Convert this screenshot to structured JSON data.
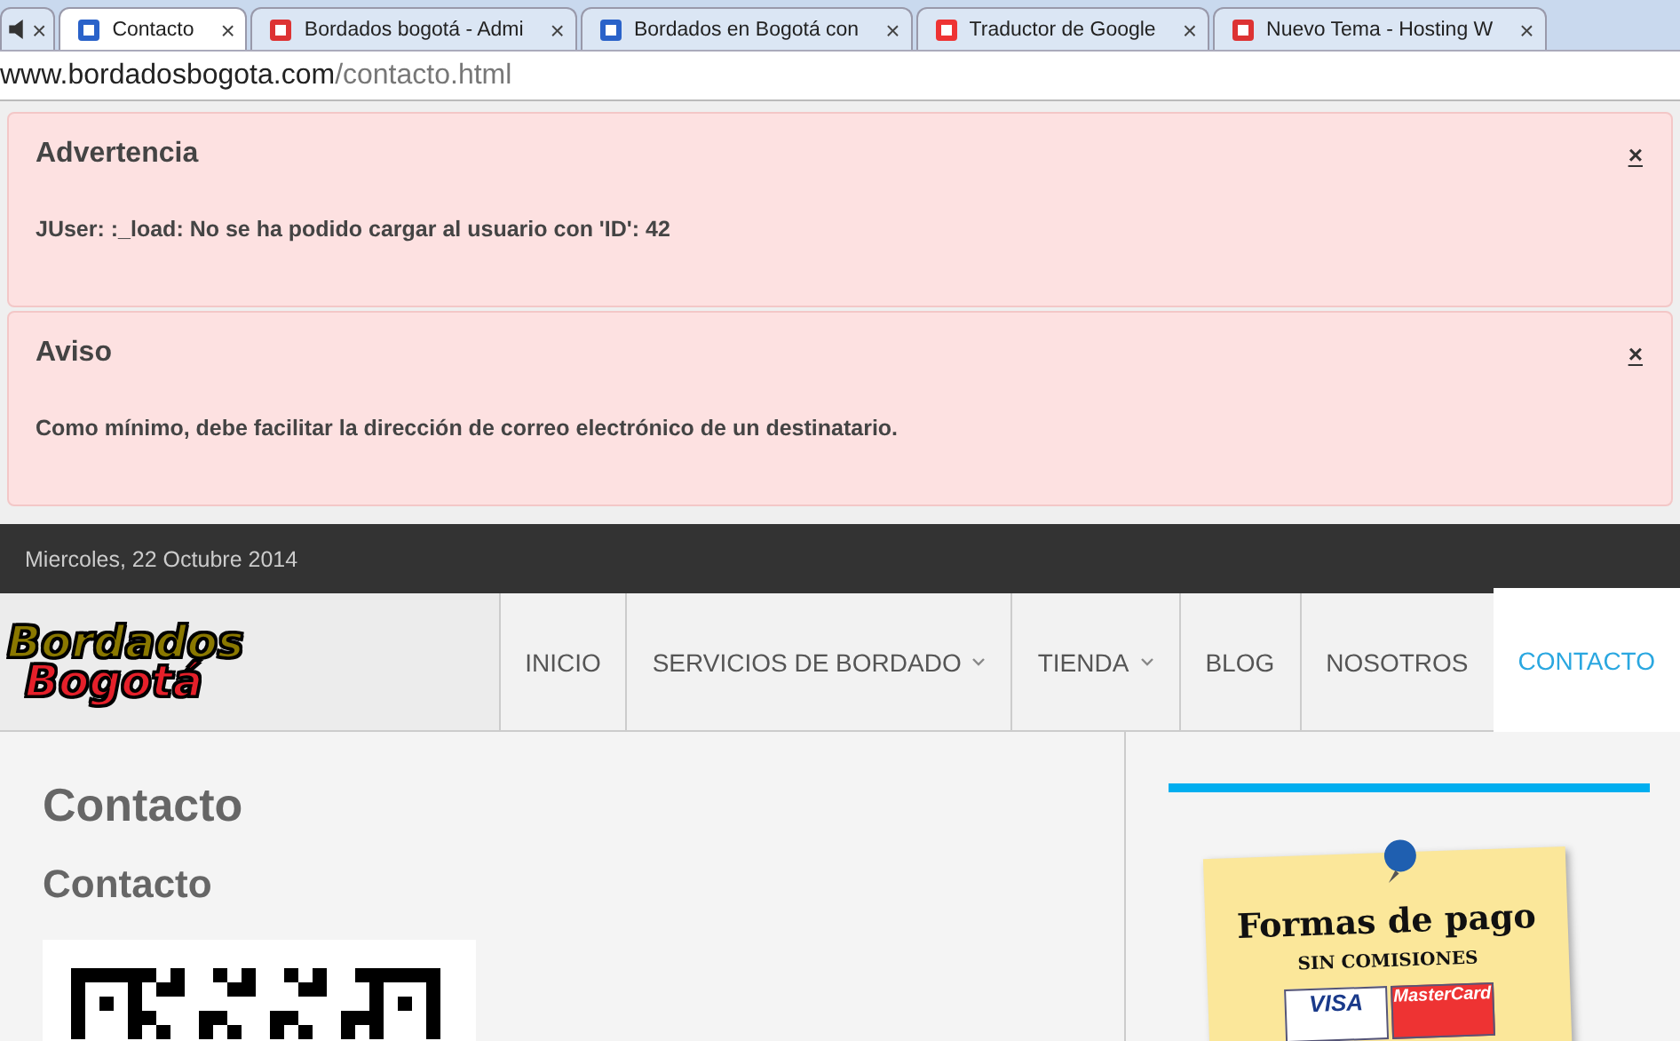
{
  "browser": {
    "tabs": [
      {
        "selected": false,
        "kind": "audio"
      },
      {
        "title": "Contacto",
        "selected": true,
        "kind": "page"
      },
      {
        "title": "Bordados bogotá - Admi",
        "selected": false,
        "kind": "page"
      },
      {
        "title": "Bordados en Bogotá con",
        "selected": false,
        "kind": "page"
      },
      {
        "title": "Traductor de Google",
        "selected": false,
        "kind": "page"
      },
      {
        "title": "Nuevo Tema - Hosting W",
        "selected": false,
        "kind": "page"
      }
    ],
    "close_glyph": "×",
    "address": {
      "host": "www.bordadosbogota.com",
      "path": "/contacto.html"
    }
  },
  "alerts": [
    {
      "title": "Advertencia",
      "close": "×",
      "message": "JUser: :_load: No se ha podido cargar al usuario con 'ID': 42"
    },
    {
      "title": "Aviso",
      "close": "×",
      "message": "Como mínimo, debe facilitar la dirección de correo electrónico de un destinatario."
    }
  ],
  "top_bar": {
    "date": "Miercoles, 22 Octubre 2014"
  },
  "logo": {
    "line_1": "Bordados",
    "line_2": "Bogotá"
  },
  "nav": [
    {
      "label": "INICIO",
      "selected": false,
      "has_menu": false
    },
    {
      "label": "SERVICIOS DE BORDADO",
      "selected": false,
      "has_menu": true
    },
    {
      "label": "TIENDA",
      "selected": false,
      "has_menu": true
    },
    {
      "label": "BLOG",
      "selected": false,
      "has_menu": false
    },
    {
      "label": "NOSOTROS",
      "selected": false,
      "has_menu": false
    },
    {
      "label": "CONTACTO",
      "selected": true,
      "has_menu": false
    }
  ],
  "content": {
    "heading": "Contacto",
    "subheading": "Contacto"
  },
  "sidebar": {
    "note": {
      "title": "Formas de pago",
      "subtitle": "SIN COMISIONES",
      "cards": [
        "VISA",
        "MasterCard"
      ]
    }
  }
}
